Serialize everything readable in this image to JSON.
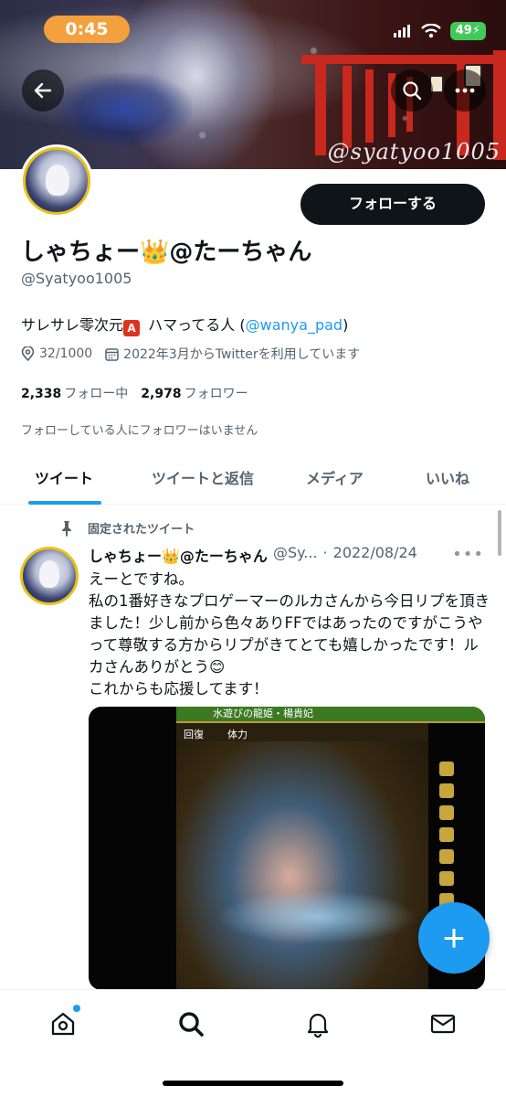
{
  "status_bar": {
    "time": "0:45",
    "battery": "49"
  },
  "banner": {
    "watermark": "@syatyoo1005"
  },
  "header": {
    "back_label": "←",
    "follow_label": "フォローする"
  },
  "profile": {
    "display_name": "しゃちょー👑@たーちゃん",
    "handle": "@Syatyoo1005",
    "bio_prefix": "サレサレ零次元",
    "bio_badge": "A",
    "bio_middle": " ハマってる人 (",
    "bio_mention": "@wanya_pad",
    "bio_suffix": ")",
    "location": "32/1000",
    "joined": "2022年3月からTwitterを利用しています",
    "following_count": "2,338",
    "following_label": "フォロー中",
    "followers_count": "2,978",
    "followers_label": "フォロワー",
    "mutual_note": "フォローしている人にフォロワーはいません"
  },
  "tabs": [
    {
      "label": "ツイート",
      "active": true
    },
    {
      "label": "ツイートと返信",
      "active": false
    },
    {
      "label": "メディア",
      "active": false
    },
    {
      "label": "いいね",
      "active": false
    }
  ],
  "tweet": {
    "pinned_label": "固定されたツイート",
    "author_name": "しゃちょー👑@たーちゃん",
    "author_handle": "@Sy...",
    "dot": "·",
    "date": "2022/08/24",
    "more": "•••",
    "text_lines": [
      "えーとですね。",
      "私の1番好きなプロゲーマーのルカさんから今日リプを頂きました！少し前から色々ありFFではあったのですがこうやって尊敬する方からリプがきてとても嬉しかったです！ルカさんありがとう😊",
      "これからも応援してます！"
    ],
    "media": {
      "top_bar_text": "水遊びの龍姫・楊貴妃",
      "tag_recover": "回復",
      "tag_hp": "体力"
    }
  },
  "fab_label": "+",
  "bottom_nav": [
    {
      "name": "home",
      "has_dot": true
    },
    {
      "name": "search",
      "has_dot": false
    },
    {
      "name": "notifications",
      "has_dot": false
    },
    {
      "name": "messages",
      "has_dot": false
    }
  ],
  "colors": {
    "accent": "#1d9bf0",
    "follow_button": "#0f1419",
    "time_pill": "#f4a03c",
    "battery": "#41c95a"
  }
}
